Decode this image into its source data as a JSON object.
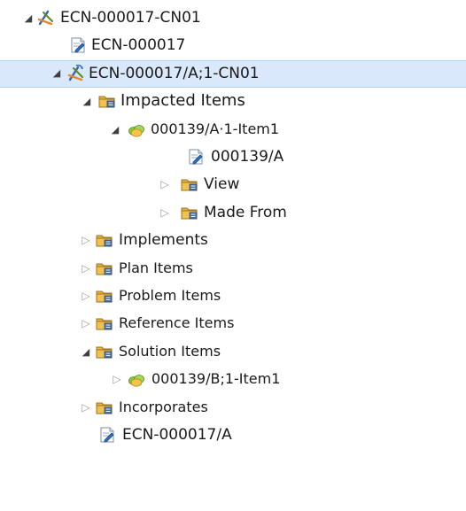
{
  "tree": {
    "nodes": [
      {
        "label": "ECN-000017-CN01",
        "icon": "change-notice-icon",
        "twisty": "expanded"
      },
      {
        "label": "ECN-000017",
        "icon": "document-revision-icon",
        "twisty": "none"
      },
      {
        "label": "ECN-000017/A;1-CN01",
        "icon": "change-notice-revision-icon",
        "twisty": "expanded",
        "selected": true
      },
      {
        "label": "Impacted Items",
        "icon": "pseudo-folder-icon",
        "twisty": "expanded"
      },
      {
        "label": "000139/A·1-Item1",
        "icon": "item-revision-icon",
        "twisty": "expanded"
      },
      {
        "label": "000139/A",
        "icon": "document-revision-icon",
        "twisty": "none"
      },
      {
        "label": "View",
        "icon": "pseudo-folder-icon",
        "twisty": "collapsed"
      },
      {
        "label": "Made From",
        "icon": "pseudo-folder-icon",
        "twisty": "collapsed"
      },
      {
        "label": "Implements",
        "icon": "pseudo-folder-icon",
        "twisty": "collapsed"
      },
      {
        "label": "Plan Items",
        "icon": "pseudo-folder-icon",
        "twisty": "collapsed"
      },
      {
        "label": "Problem Items",
        "icon": "pseudo-folder-icon",
        "twisty": "collapsed"
      },
      {
        "label": "Reference Items",
        "icon": "pseudo-folder-icon",
        "twisty": "collapsed"
      },
      {
        "label": "Solution Items",
        "icon": "pseudo-folder-icon",
        "twisty": "expanded"
      },
      {
        "label": "000139/B;1-Item1",
        "icon": "item-revision-icon",
        "twisty": "collapsed"
      },
      {
        "label": "Incorporates",
        "icon": "pseudo-folder-icon",
        "twisty": "collapsed"
      },
      {
        "label": "ECN-000017/A",
        "icon": "document-revision-icon",
        "twisty": "none"
      }
    ]
  },
  "colors": {
    "selection_background": "#d9e8fb",
    "folder_body": "#f2c14e",
    "item_green": "#8cc63f",
    "doc_blue": "#2f6fc1"
  }
}
